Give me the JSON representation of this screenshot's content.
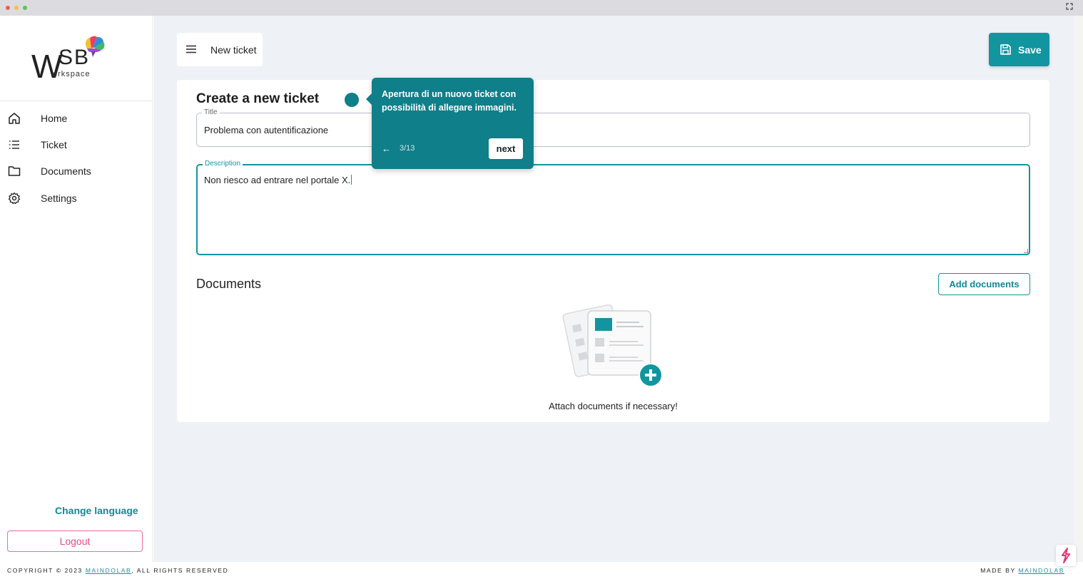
{
  "app": {
    "logo_main": "W",
    "logo_sb": "SB",
    "logo_sub": "orkspace"
  },
  "sidebar": {
    "items": [
      {
        "label": "Home",
        "icon": "home-icon"
      },
      {
        "label": "Ticket",
        "icon": "list-icon"
      },
      {
        "label": "Documents",
        "icon": "folder-icon"
      },
      {
        "label": "Settings",
        "icon": "gear-icon"
      }
    ],
    "change_language": "Change language",
    "logout": "Logout"
  },
  "header": {
    "title": "New ticket",
    "save_label": "Save"
  },
  "form": {
    "heading": "Create a new ticket",
    "title_label": "Title",
    "title_value": "Problema con autentificazione",
    "description_label": "Description",
    "description_value": "Non riesco ad entrare nel portale X."
  },
  "documents": {
    "heading": "Documents",
    "add_label": "Add documents",
    "empty_text": "Attach documents if necessary!"
  },
  "tour": {
    "text": "Apertura di un nuovo ticket con possibilità di allegare immagini.",
    "back": "←",
    "progress": "3/13",
    "next": "next"
  },
  "footer": {
    "left_prefix": "COPYRIGHT © 2023 ",
    "left_link": "MAINDOLAB",
    "left_suffix": ", ALL RIGHTS RESERVED",
    "right_prefix": "MADE BY ",
    "right_link": "MAINDOLAB"
  },
  "colors": {
    "accent": "#12959f",
    "tour": "#0f7f89",
    "logout": "#e94a84",
    "background": "#eef1f6"
  }
}
